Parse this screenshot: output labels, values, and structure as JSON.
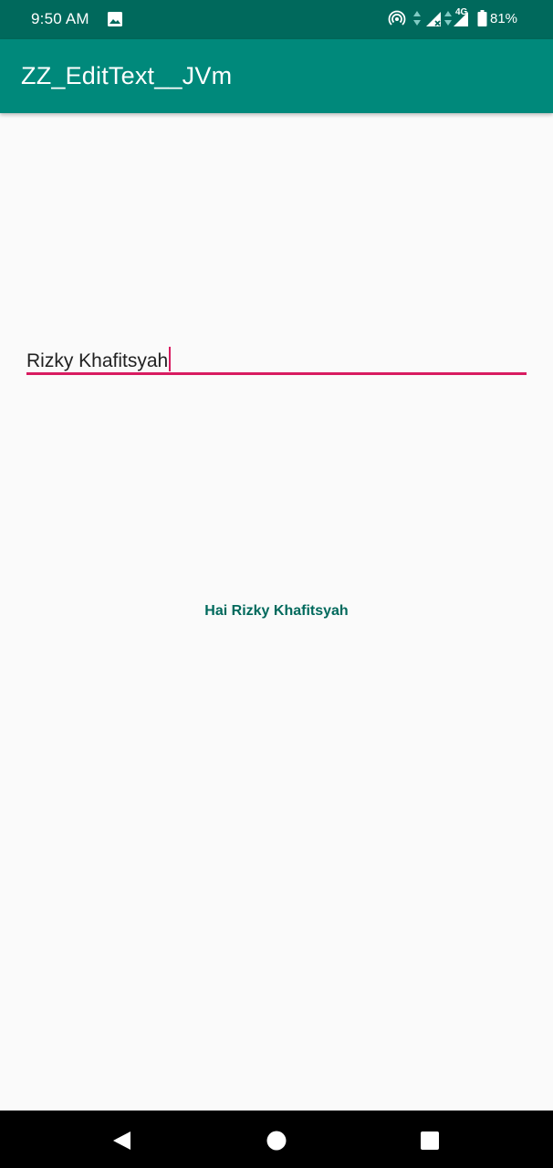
{
  "status_bar": {
    "time": "9:50 AM",
    "network_type": "4G",
    "battery_percent": "81%",
    "icons": [
      "gallery-icon",
      "hotspot-icon",
      "signal-icon",
      "battery-icon"
    ]
  },
  "app_bar": {
    "title": "ZZ_EditText__JVm"
  },
  "edit_text": {
    "value": "Rizky Khafitsyah",
    "underline_color": "#d81b60"
  },
  "greeting": {
    "text": "Hai Rizky Khafitsyah",
    "color": "#00695c"
  },
  "nav_bar": {
    "buttons": [
      "back-icon",
      "home-icon",
      "recents-icon"
    ]
  },
  "colors": {
    "status_bar": "#00695c",
    "app_bar": "#00897b",
    "accent": "#d81b60",
    "background": "#fafafa"
  }
}
